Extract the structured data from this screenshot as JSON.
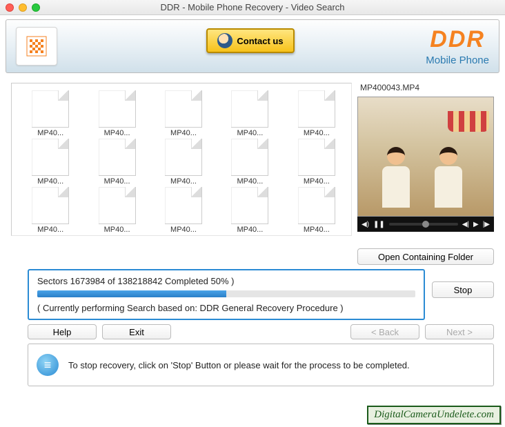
{
  "window": {
    "title": "DDR - Mobile Phone Recovery - Video Search"
  },
  "header": {
    "contact_label": "Contact us",
    "brand_main": "DDR",
    "brand_sub": "Mobile Phone"
  },
  "files": {
    "items": [
      {
        "label": "MP40..."
      },
      {
        "label": "MP40..."
      },
      {
        "label": "MP40..."
      },
      {
        "label": "MP40..."
      },
      {
        "label": "MP40..."
      },
      {
        "label": "MP40..."
      },
      {
        "label": "MP40..."
      },
      {
        "label": "MP40..."
      },
      {
        "label": "MP40..."
      },
      {
        "label": "MP40..."
      },
      {
        "label": "MP40..."
      },
      {
        "label": "MP40..."
      },
      {
        "label": "MP40..."
      },
      {
        "label": "MP40..."
      },
      {
        "label": "MP40..."
      }
    ]
  },
  "preview": {
    "filename": "MP400043.MP4",
    "open_folder": "Open Containing Folder"
  },
  "progress": {
    "text": "Sectors 1673984 of   138218842  Completed 50% )",
    "percent": 50,
    "subtext": "( Currently performing Search based on: DDR General Recovery Procedure )",
    "stop": "Stop"
  },
  "buttons": {
    "help": "Help",
    "exit": "Exit",
    "back": "< Back",
    "next": "Next >"
  },
  "info": {
    "text": "To stop recovery, click on 'Stop' Button or please wait for the process to be completed."
  },
  "watermark": "DigitalCameraUndelete.com"
}
